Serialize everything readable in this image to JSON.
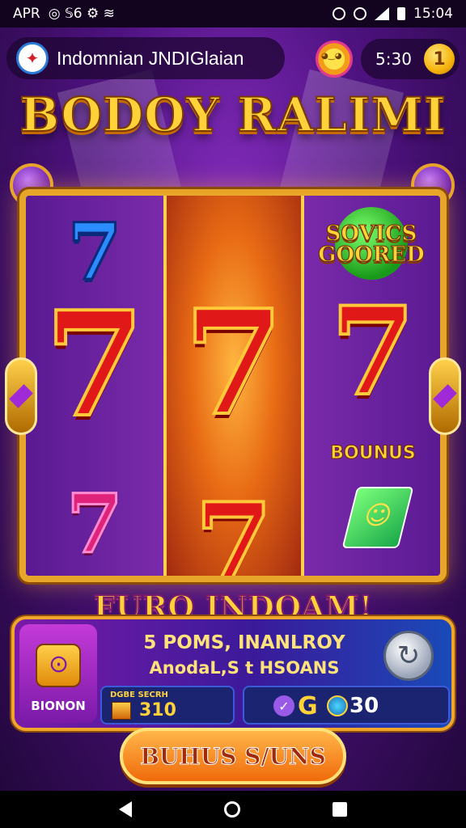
{
  "status_bar": {
    "carrier": "APR",
    "status_icons": "◎ 𝕊6 ⚙ ≋",
    "time": "15:04"
  },
  "header": {
    "app_title": "Indomnian JNDIGlaian",
    "balance_time": "5:30",
    "coin_label": "1"
  },
  "game": {
    "logo": "BODOY RALIMI",
    "bonus_sign_line1": "SOVICS",
    "bonus_sign_line2": "GOORED",
    "bonus_word": "BOUNUS",
    "prize_text": "FURO INDOAM!"
  },
  "panel": {
    "line1": "5 POMS, INANLROY",
    "line2": "AnodaL,S t HSOANS",
    "bonus_label": "BIONON",
    "stat1_caption": "DGBE SECRH",
    "stat1_value": "310",
    "stat2_label": "G",
    "stat2_value": "30"
  },
  "spin_button": "BUHUS S/UNS",
  "colors": {
    "gold": "#ffd23a",
    "frame": "#e7a52a",
    "reel_red": "#e01818",
    "panel_purple": "#7a1aa8"
  }
}
